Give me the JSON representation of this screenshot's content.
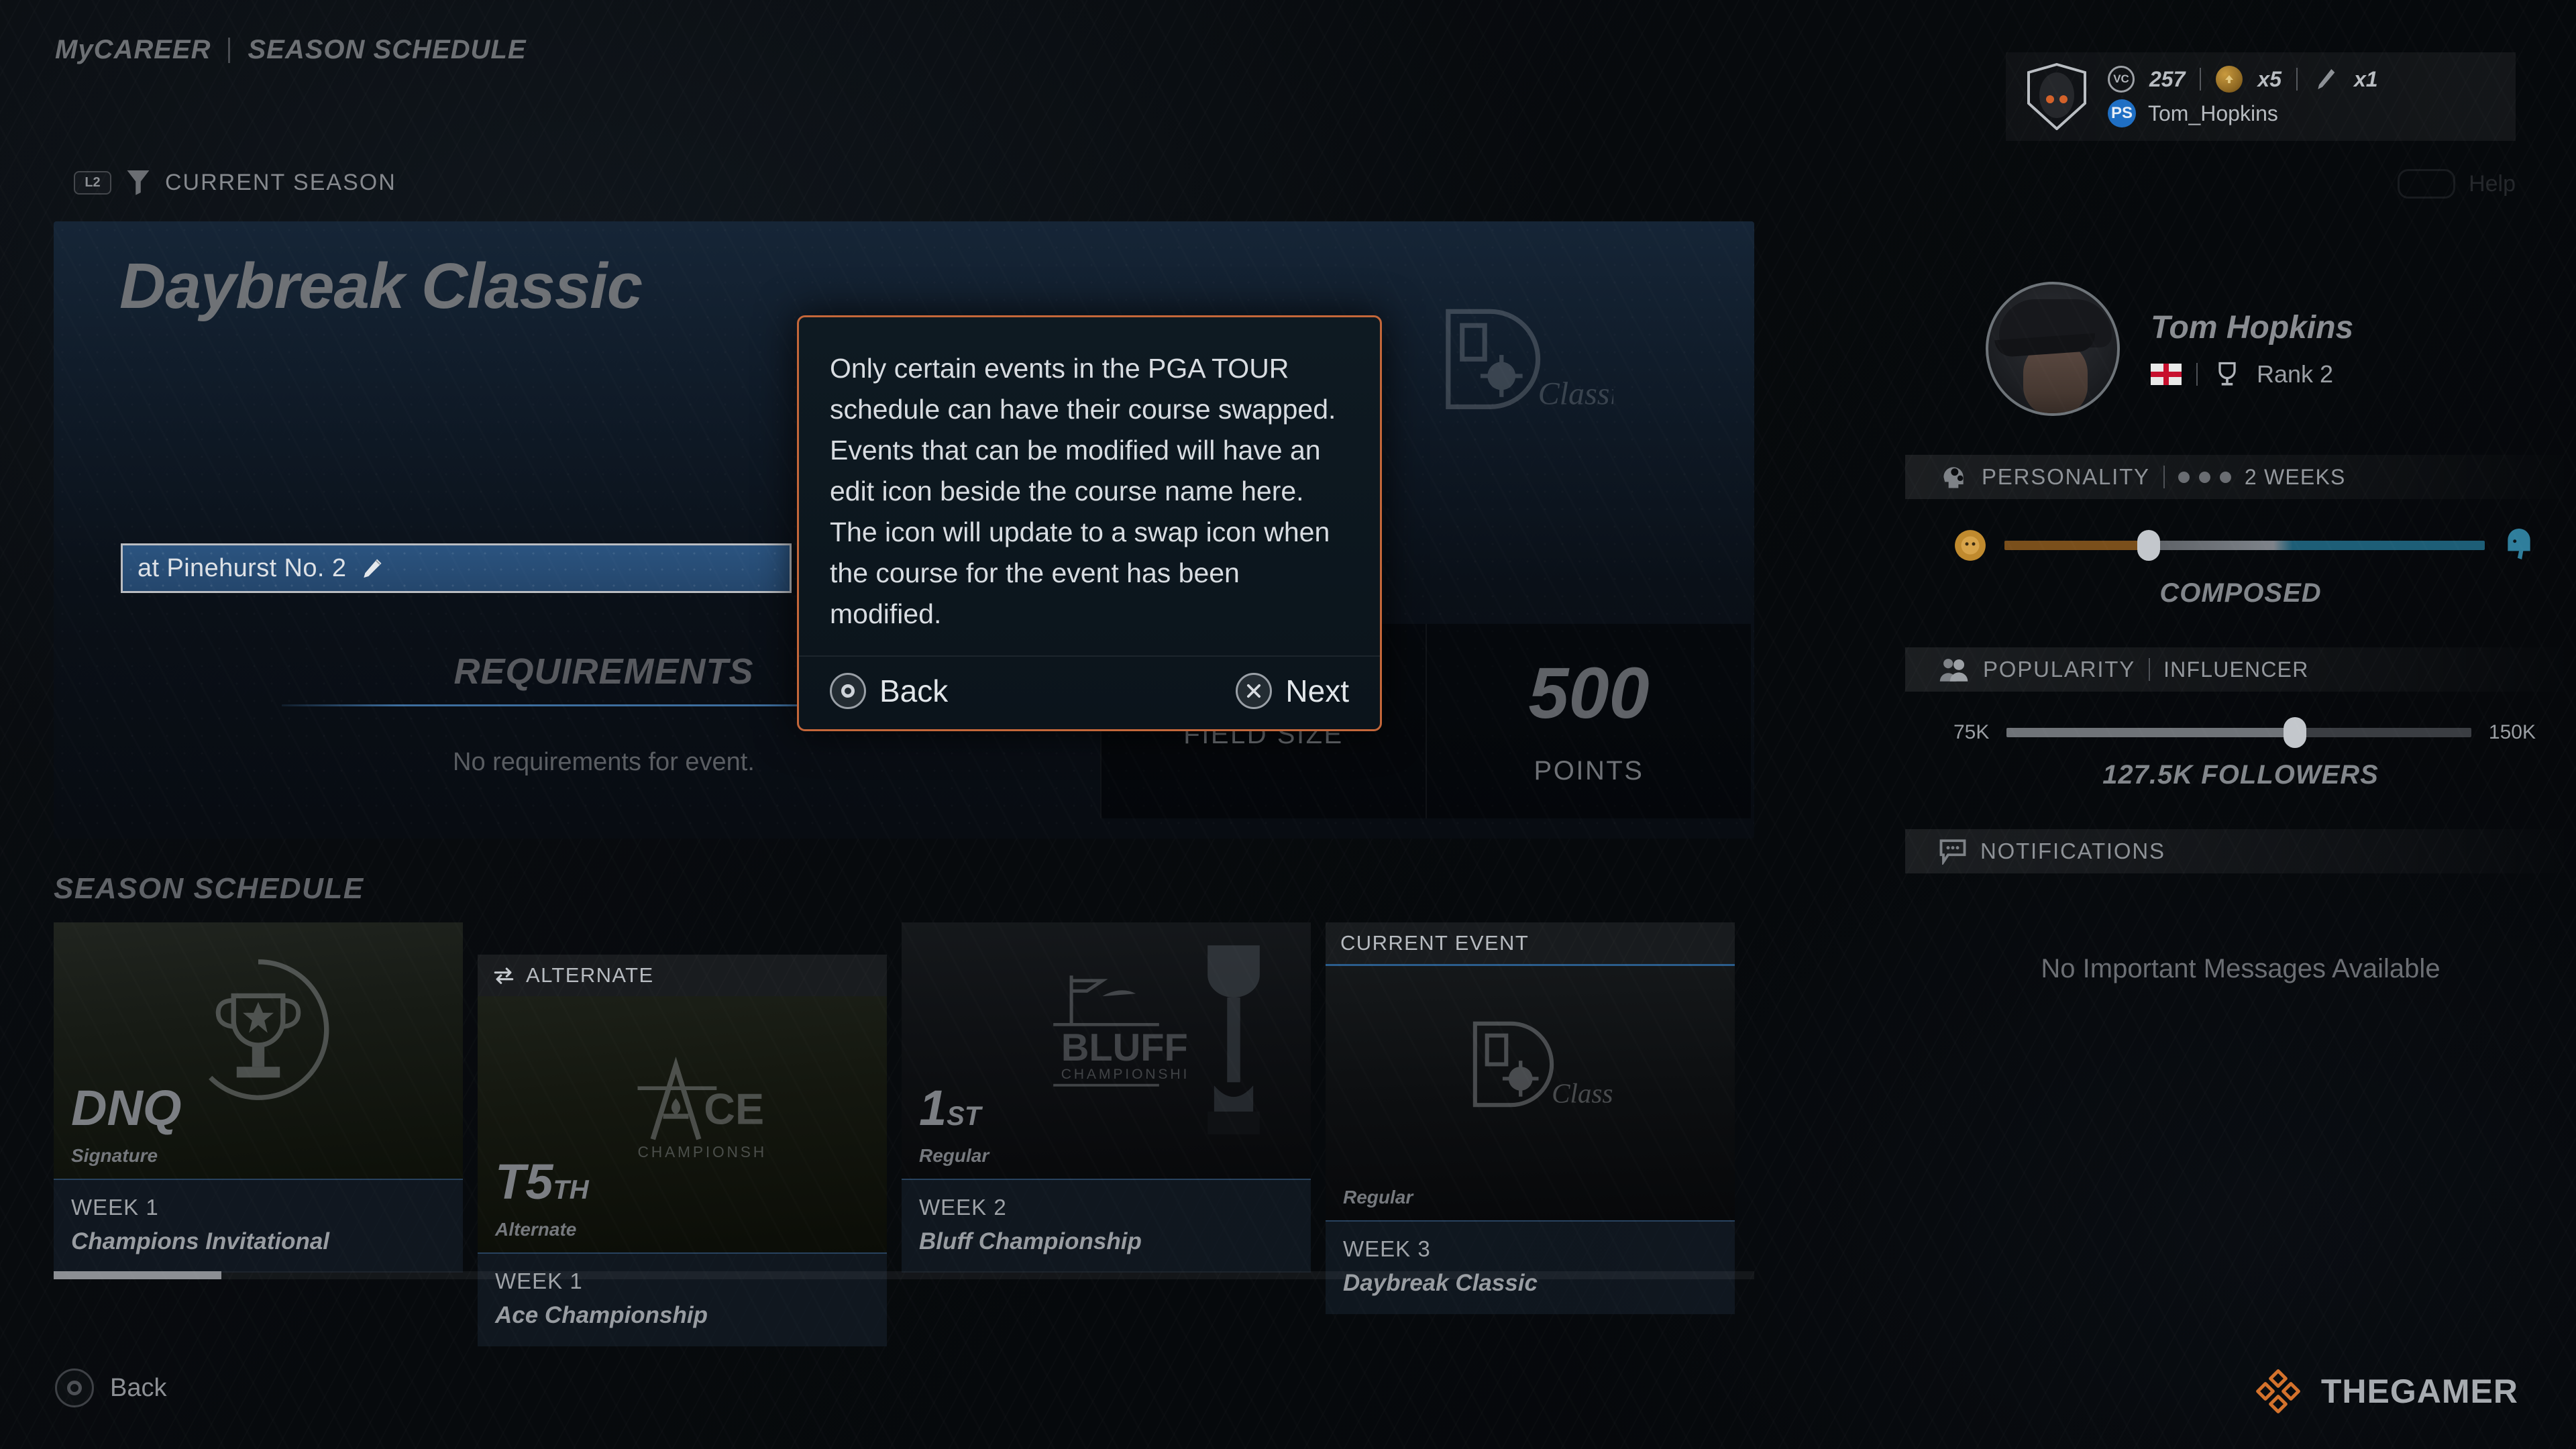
{
  "header": {
    "breadcrumb_primary": "MyCAREER",
    "breadcrumb_secondary": "SEASON SCHEDULE",
    "filter_button_badge": "L2",
    "filter_label": "CURRENT SEASON",
    "help_label": "Help"
  },
  "account": {
    "vc_symbol": "VC",
    "vc_amount": "257",
    "boost_multiplier": "x5",
    "item_multiplier": "x1",
    "platform_username": "Tom_Hopkins"
  },
  "event": {
    "title": "Daybreak Classic",
    "course_label": "at Pinehurst No. 2",
    "requirements_heading": "REQUIREMENTS",
    "requirements_text": "No requirements for event.",
    "logo_mark": "DB",
    "logo_script": "Classic",
    "stats": [
      {
        "value": "",
        "label": "FIELD SIZE"
      },
      {
        "value": "500",
        "label": "POINTS"
      }
    ]
  },
  "tooltip": {
    "body": "Only certain events in the PGA TOUR schedule can have their course swapped. Events that can be modified will have an edit icon beside the course name here. The icon will update to a swap icon when the course for the event has been modified.",
    "back_label": "Back",
    "next_label": "Next",
    "border_color": "#c4673a"
  },
  "schedule": {
    "section_title": "SEASON SCHEDULE",
    "cards": [
      {
        "badge": "",
        "result": "DNQ",
        "result_suffix": "",
        "type": "Signature",
        "week": "WEEK 1",
        "name": "Champions Invitational",
        "art_logo": "trophy-crest"
      },
      {
        "badge": "ALTERNATE",
        "result": "T5",
        "result_suffix": "TH",
        "type": "Alternate",
        "week": "WEEK 1",
        "name": "Ace Championship",
        "art_logo": "ace-championship"
      },
      {
        "badge": "",
        "result": "1",
        "result_suffix": "ST",
        "type": "Regular",
        "week": "WEEK 2",
        "name": "Bluff Championship",
        "art_logo": "bluff-championship"
      },
      {
        "badge": "CURRENT EVENT",
        "result": "",
        "result_suffix": "",
        "type": "Regular",
        "week": "WEEK 3",
        "name": "Daybreak Classic",
        "art_logo": "daybreak-classic"
      }
    ]
  },
  "player": {
    "name": "Tom Hopkins",
    "country": "England",
    "rank": "Rank 2"
  },
  "personality": {
    "heading": "PERSONALITY",
    "duration": "2 WEEKS",
    "dots": 3,
    "value_label": "COMPOSED",
    "slider_percent": 30,
    "left_icon": "lion-icon",
    "right_icon": "elephant-icon"
  },
  "popularity": {
    "heading": "POPULARITY",
    "tier": "INFLUENCER",
    "min_label": "75K",
    "max_label": "150K",
    "value_label": "127.5K FOLLOWERS",
    "slider_percent": 62
  },
  "notifications": {
    "heading": "NOTIFICATIONS",
    "empty_text": "No Important Messages Available"
  },
  "footer": {
    "back_label": "Back",
    "watermark": "THEGAMER"
  }
}
